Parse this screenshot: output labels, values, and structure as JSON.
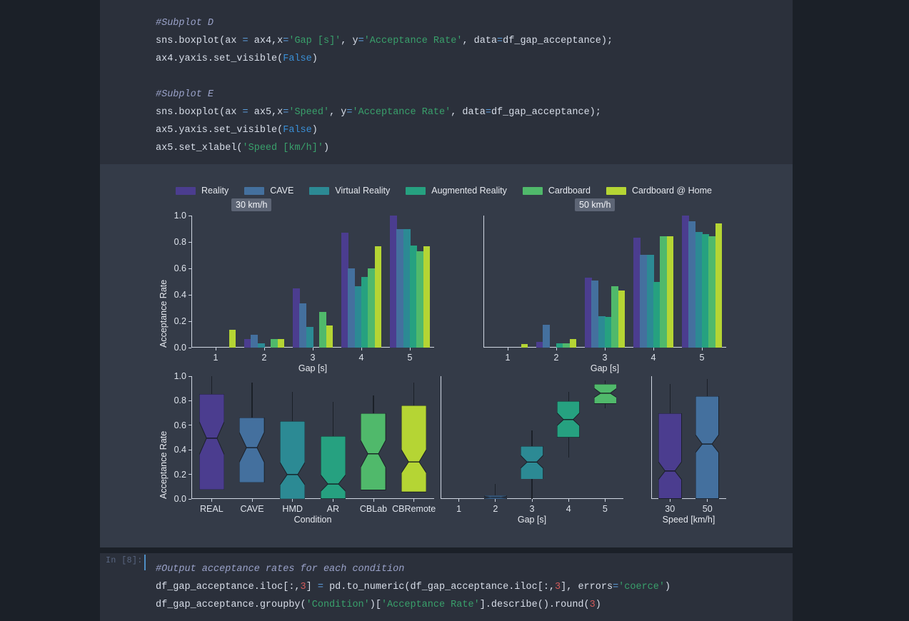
{
  "notebook": {
    "top_cell": {
      "lines": [
        {
          "segs": [
            {
              "t": "#Subplot D",
              "c": "cm"
            }
          ]
        },
        {
          "segs": [
            {
              "t": "sns.boxplot(ax ",
              "c": "pl"
            },
            {
              "t": "=",
              "c": "op"
            },
            {
              "t": " ax4,x",
              "c": "pl"
            },
            {
              "t": "=",
              "c": "op"
            },
            {
              "t": "'Gap [s]'",
              "c": "st"
            },
            {
              "t": ", y",
              "c": "pl"
            },
            {
              "t": "=",
              "c": "op"
            },
            {
              "t": "'Acceptance Rate'",
              "c": "st"
            },
            {
              "t": ", data",
              "c": "pl"
            },
            {
              "t": "=",
              "c": "op"
            },
            {
              "t": "df_gap_acceptance);",
              "c": "pl"
            }
          ]
        },
        {
          "segs": [
            {
              "t": "ax4.yaxis.set_visible(",
              "c": "pl"
            },
            {
              "t": "False",
              "c": "kw"
            },
            {
              "t": ")",
              "c": "pl"
            }
          ]
        },
        {
          "segs": [
            {
              "t": "",
              "c": "pl"
            }
          ]
        },
        {
          "segs": [
            {
              "t": "#Subplot E",
              "c": "cm"
            }
          ]
        },
        {
          "segs": [
            {
              "t": "sns.boxplot(ax ",
              "c": "pl"
            },
            {
              "t": "=",
              "c": "op"
            },
            {
              "t": " ax5,x",
              "c": "pl"
            },
            {
              "t": "=",
              "c": "op"
            },
            {
              "t": "'Speed'",
              "c": "st"
            },
            {
              "t": ", y",
              "c": "pl"
            },
            {
              "t": "=",
              "c": "op"
            },
            {
              "t": "'Acceptance Rate'",
              "c": "st"
            },
            {
              "t": ", data",
              "c": "pl"
            },
            {
              "t": "=",
              "c": "op"
            },
            {
              "t": "df_gap_acceptance);",
              "c": "pl"
            }
          ]
        },
        {
          "segs": [
            {
              "t": "ax5.yaxis.set_visible(",
              "c": "pl"
            },
            {
              "t": "False",
              "c": "kw"
            },
            {
              "t": ")",
              "c": "pl"
            }
          ]
        },
        {
          "segs": [
            {
              "t": "ax5.set_xlabel(",
              "c": "pl"
            },
            {
              "t": "'Speed [km/h]'",
              "c": "st"
            },
            {
              "t": ")",
              "c": "pl"
            }
          ]
        }
      ]
    },
    "bottom_cell": {
      "prompt": "In [8]:",
      "lines": [
        {
          "segs": [
            {
              "t": "#Output acceptance rates for each condition",
              "c": "cm"
            }
          ]
        },
        {
          "segs": [
            {
              "t": "df_gap_acceptance.iloc[:,",
              "c": "pl"
            },
            {
              "t": "3",
              "c": "nu"
            },
            {
              "t": "] ",
              "c": "pl"
            },
            {
              "t": "=",
              "c": "op"
            },
            {
              "t": " pd.to_numeric(df_gap_acceptance.iloc[:,",
              "c": "pl"
            },
            {
              "t": "3",
              "c": "nu"
            },
            {
              "t": "], errors",
              "c": "pl"
            },
            {
              "t": "=",
              "c": "op"
            },
            {
              "t": "'coerce'",
              "c": "st"
            },
            {
              "t": ")",
              "c": "pl"
            }
          ]
        },
        {
          "segs": [
            {
              "t": "df_gap_acceptance.groupby(",
              "c": "pl"
            },
            {
              "t": "'Condition'",
              "c": "st"
            },
            {
              "t": ")[",
              "c": "pl"
            },
            {
              "t": "'Acceptance Rate'",
              "c": "st"
            },
            {
              "t": "].describe().round(",
              "c": "pl"
            },
            {
              "t": "3",
              "c": "nu"
            },
            {
              "t": ")",
              "c": "pl"
            }
          ]
        }
      ]
    }
  },
  "figure": {
    "legend": {
      "entries": [
        {
          "label": "Reality",
          "color": "#4b3d8f"
        },
        {
          "label": "CAVE",
          "color": "#44709e"
        },
        {
          "label": "Virtual Reality",
          "color": "#2c8a94"
        },
        {
          "label": "Augmented Reality",
          "color": "#26a180"
        },
        {
          "label": "Cardboard",
          "color": "#50b96b"
        },
        {
          "label": "Cardboard @ Home",
          "color": "#b5d534"
        }
      ]
    },
    "conditions": [
      "Reality",
      "CAVE",
      "Virtual Reality",
      "Augmented Reality",
      "Cardboard",
      "Cardboard @ Home"
    ],
    "colors": [
      "#4b3d8f",
      "#44709e",
      "#2c8a94",
      "#26a180",
      "#50b96b",
      "#b5d534"
    ]
  },
  "chart_data": [
    {
      "type": "bar",
      "name": "subplot-a-30kmh",
      "title": "30 km/h",
      "xlabel": "Gap [s]",
      "ylabel": "Acceptance Rate",
      "categories": [
        "1",
        "2",
        "3",
        "4",
        "5"
      ],
      "yticks": [
        "0.0",
        "0.2",
        "0.4",
        "0.6",
        "0.8",
        "1.0"
      ],
      "ylim": [
        0,
        1.0
      ],
      "grid": false,
      "legend_position": "figure-top",
      "series": [
        {
          "name": "Reality",
          "color": "#4b3d8f",
          "values": [
            0,
            0.065,
            0.45,
            0.87,
            1.0
          ]
        },
        {
          "name": "CAVE",
          "color": "#44709e",
          "values": [
            0,
            0.1,
            0.335,
            0.6,
            0.9
          ]
        },
        {
          "name": "Virtual Reality",
          "color": "#2c8a94",
          "values": [
            0,
            0.035,
            0.155,
            0.465,
            0.9
          ]
        },
        {
          "name": "Augmented Reality",
          "color": "#26a180",
          "values": [
            0,
            0,
            0,
            0.535,
            0.775
          ]
        },
        {
          "name": "Cardboard",
          "color": "#50b96b",
          "values": [
            0,
            0.065,
            0.27,
            0.6,
            0.73
          ]
        },
        {
          "name": "Cardboard @ Home",
          "color": "#b5d534",
          "values": [
            0.135,
            0.065,
            0.17,
            0.765,
            0.765
          ]
        }
      ]
    },
    {
      "type": "bar",
      "name": "subplot-b-50kmh",
      "title": "50 km/h",
      "xlabel": "Gap [s]",
      "ylabel": "",
      "categories": [
        "1",
        "2",
        "3",
        "4",
        "5"
      ],
      "ylim": [
        0,
        1.0
      ],
      "grid": false,
      "series": [
        {
          "name": "Reality",
          "color": "#4b3d8f",
          "values": [
            0,
            0.045,
            0.53,
            0.835,
            1.0
          ]
        },
        {
          "name": "CAVE",
          "color": "#44709e",
          "values": [
            0,
            0.175,
            0.51,
            0.705,
            0.955
          ]
        },
        {
          "name": "Virtual Reality",
          "color": "#2c8a94",
          "values": [
            0,
            0,
            0.24,
            0.705,
            0.875
          ]
        },
        {
          "name": "Augmented Reality",
          "color": "#26a180",
          "values": [
            0,
            0.035,
            0.235,
            0.5,
            0.86
          ]
        },
        {
          "name": "Cardboard",
          "color": "#50b96b",
          "values": [
            0,
            0.035,
            0.465,
            0.845,
            0.845
          ]
        },
        {
          "name": "Cardboard @ Home",
          "color": "#b5d534",
          "values": [
            0.025,
            0.065,
            0.43,
            0.845,
            0.94
          ]
        }
      ]
    },
    {
      "type": "box",
      "name": "subplot-c-condition",
      "xlabel": "Condition",
      "ylabel": "Acceptance Rate",
      "yticks": [
        "0.0",
        "0.2",
        "0.4",
        "0.6",
        "0.8",
        "1.0"
      ],
      "ylim": [
        0,
        1.0
      ],
      "categories": [
        "REAL",
        "CAVE",
        "HMD",
        "AR",
        "CBLab",
        "CBRemote"
      ],
      "boxes": [
        {
          "label": "REAL",
          "color": "#4b3d8f",
          "q1": 0.075,
          "median": 0.495,
          "q3": 0.855,
          "low": 0.075,
          "high": 1.0,
          "notch_lo": 0.36,
          "notch_hi": 0.63
        },
        {
          "label": "CAVE",
          "color": "#44709e",
          "q1": 0.135,
          "median": 0.42,
          "q3": 0.665,
          "low": 0.135,
          "high": 0.945,
          "notch_lo": 0.3,
          "notch_hi": 0.545
        },
        {
          "label": "HMD",
          "color": "#2c8a94",
          "q1": 0.0,
          "median": 0.2,
          "q3": 0.635,
          "low": -0.02,
          "high": 0.875,
          "notch_lo": 0.115,
          "notch_hi": 0.3
        },
        {
          "label": "AR",
          "color": "#26a180",
          "q1": 0.0,
          "median": 0.12,
          "q3": 0.51,
          "low": -0.02,
          "high": 0.79,
          "notch_lo": 0.06,
          "notch_hi": 0.195
        },
        {
          "label": "CBLab",
          "color": "#50b96b",
          "q1": 0.07,
          "median": 0.365,
          "q3": 0.695,
          "low": 0.07,
          "high": 0.845,
          "notch_lo": 0.255,
          "notch_hi": 0.475
        },
        {
          "label": "CBRemote",
          "color": "#b5d534",
          "q1": 0.055,
          "median": 0.3,
          "q3": 0.76,
          "low": 0.055,
          "high": 0.95,
          "notch_lo": 0.21,
          "notch_hi": 0.4
        }
      ]
    },
    {
      "type": "box",
      "name": "subplot-d-gap",
      "xlabel": "Gap [s]",
      "ylabel": "",
      "ylim": [
        0,
        1.0
      ],
      "categories": [
        "1",
        "2",
        "3",
        "4",
        "5"
      ],
      "boxes": [
        {
          "label": "1",
          "color": "#4b3d8f",
          "q1": 0.0,
          "median": 0.0,
          "q3": 0.0,
          "low": 0.0,
          "high": 0.0,
          "notch_lo": 0.0,
          "notch_hi": 0.0
        },
        {
          "label": "2",
          "color": "#44709e",
          "q1": 0.0,
          "median": 0.015,
          "q3": 0.03,
          "low": 0.0,
          "high": 0.12,
          "notch_lo": 0.008,
          "notch_hi": 0.022
        },
        {
          "label": "3",
          "color": "#2c8a94",
          "q1": 0.16,
          "median": 0.3,
          "q3": 0.43,
          "low": 0.0,
          "high": 0.56,
          "notch_lo": 0.25,
          "notch_hi": 0.355
        },
        {
          "label": "4",
          "color": "#26a180",
          "q1": 0.5,
          "median": 0.645,
          "q3": 0.795,
          "low": 0.34,
          "high": 0.875,
          "notch_lo": 0.595,
          "notch_hi": 0.7
        },
        {
          "label": "5",
          "color": "#50b96b",
          "q1": 0.775,
          "median": 0.86,
          "q3": 0.935,
          "low": 0.74,
          "high": 0.965,
          "notch_lo": 0.825,
          "notch_hi": 0.9
        }
      ]
    },
    {
      "type": "box",
      "name": "subplot-e-speed",
      "xlabel": "Speed [km/h]",
      "ylabel": "",
      "ylim": [
        0,
        1.0
      ],
      "categories": [
        "30",
        "50"
      ],
      "boxes": [
        {
          "label": "30",
          "color": "#4b3d8f",
          "q1": 0.0,
          "median": 0.225,
          "q3": 0.695,
          "low": 0.0,
          "high": 0.935,
          "notch_lo": 0.155,
          "notch_hi": 0.3
        },
        {
          "label": "50",
          "color": "#44709e",
          "q1": 0.0,
          "median": 0.445,
          "q3": 0.835,
          "low": 0.0,
          "high": 0.975,
          "notch_lo": 0.375,
          "notch_hi": 0.52
        }
      ]
    }
  ]
}
